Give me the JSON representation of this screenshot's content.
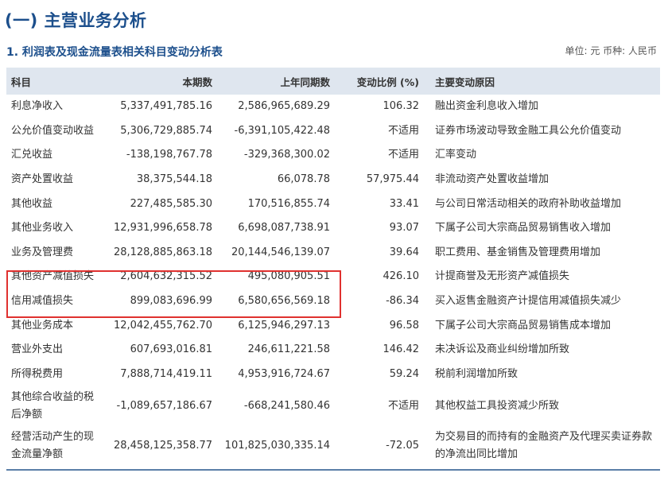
{
  "section_title": "(一) 主营业务分析",
  "sub_title": "1. 利润表及现金流量表相关科目变动分析表",
  "unit_note": "单位: 元  币种: 人民币",
  "table": {
    "headers": [
      "科目",
      "本期数",
      "上年同期数",
      "变动比例 (%)",
      "主要变动原因"
    ],
    "rows": [
      {
        "item": "利息净收入",
        "current": "5,337,491,785.16",
        "prior": "2,586,965,689.29",
        "change": "106.32",
        "reason": "融出资金利息收入增加"
      },
      {
        "item": "公允价值变动收益",
        "current": "5,306,729,885.74",
        "prior": "-6,391,105,422.48",
        "change": "不适用",
        "reason": "证券市场波动导致金融工具公允价值变动"
      },
      {
        "item": "汇兑收益",
        "current": "-138,198,767.78",
        "prior": "-329,368,300.02",
        "change": "不适用",
        "reason": "汇率变动"
      },
      {
        "item": "资产处置收益",
        "current": "38,375,544.18",
        "prior": "66,078.78",
        "change": "57,975.44",
        "reason": "非流动资产处置收益增加"
      },
      {
        "item": "其他收益",
        "current": "227,485,585.30",
        "prior": "170,516,855.74",
        "change": "33.41",
        "reason": "与公司日常活动相关的政府补助收益增加"
      },
      {
        "item": "其他业务收入",
        "current": "12,931,996,658.78",
        "prior": "6,698,087,738.91",
        "change": "93.07",
        "reason": "下属子公司大宗商品贸易销售收入增加"
      },
      {
        "item": "业务及管理费",
        "current": "28,128,885,863.18",
        "prior": "20,144,546,139.07",
        "change": "39.64",
        "reason": "职工费用、基金销售及管理费用增加"
      },
      {
        "item": "其他资产减值损失",
        "current": "2,604,632,315.52",
        "prior": "495,080,905.51",
        "change": "426.10",
        "reason": "计提商誉及无形资产减值损失"
      },
      {
        "item": "信用减值损失",
        "current": "899,083,696.99",
        "prior": "6,580,656,569.18",
        "change": "-86.34",
        "reason": "买入返售金融资产计提信用减值损失减少"
      },
      {
        "item": "其他业务成本",
        "current": "12,042,455,762.70",
        "prior": "6,125,946,297.13",
        "change": "96.58",
        "reason": "下属子公司大宗商品贸易销售成本增加"
      },
      {
        "item": "营业外支出",
        "current": "607,693,016.81",
        "prior": "246,611,221.58",
        "change": "146.42",
        "reason": "未决诉讼及商业纠纷增加所致"
      },
      {
        "item": "所得税费用",
        "current": "7,888,714,419.11",
        "prior": "4,953,916,724.67",
        "change": "59.24",
        "reason": "税前利润增加所致"
      },
      {
        "item": "其他综合收益的税后净额",
        "current": "-1,089,657,186.67",
        "prior": "-668,241,580.46",
        "change": "不适用",
        "reason": "其他权益工具投资减少所致"
      },
      {
        "item": "经营活动产生的现金流量净额",
        "current": "28,458,125,358.77",
        "prior": "101,825,030,335.14",
        "change": "-72.05",
        "reason": "为交易目的而持有的金融资产及代理买卖证券款的净流出同比增加"
      }
    ]
  },
  "colors": {
    "title": "#1c4f8c",
    "header_bg": "#dfe6ef",
    "highlight_border": "#e0312f",
    "text": "#333333"
  }
}
